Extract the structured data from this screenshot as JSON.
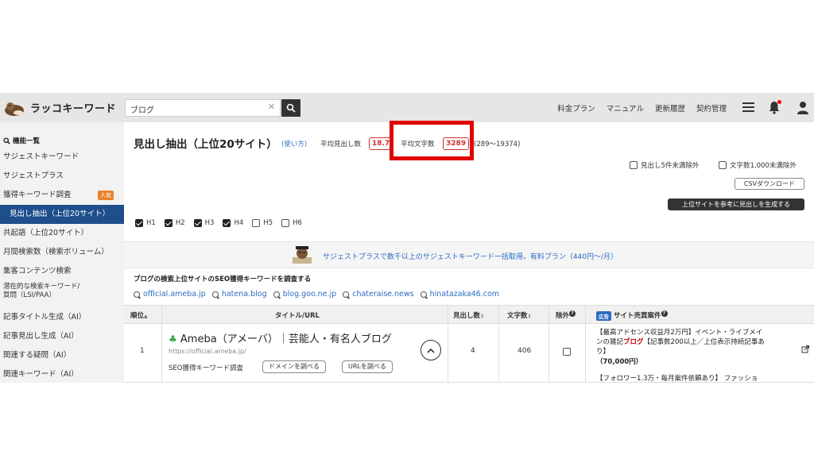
{
  "header": {
    "brand": "ラッコキーワード",
    "search_value": "ブログ",
    "nav": [
      "料金プラン",
      "マニュアル",
      "更新履歴",
      "契約管理"
    ]
  },
  "sidebar": {
    "heading": "機能一覧",
    "items": [
      {
        "label": "サジェストキーワード"
      },
      {
        "label": "サジェストプラス"
      },
      {
        "label": "獲得キーワード調査",
        "badge": "人気"
      },
      {
        "label": "見出し抽出（上位20サイト）",
        "active": true
      },
      {
        "label": "共起語（上位20サイト）"
      },
      {
        "label": "月間検索数（検索ボリューム）"
      },
      {
        "label": "集客コンテンツ検索"
      },
      {
        "label_line1": "潜在的な検索キーワード/",
        "label_line2": "質問（LSI/PAA）"
      },
      {
        "label": "記事タイトル生成（AI）"
      },
      {
        "label": "記事見出し生成（AI）"
      },
      {
        "label": "関連する疑問（AI）"
      },
      {
        "label": "関連キーワード（AI）"
      }
    ]
  },
  "main": {
    "title": "見出し抽出（上位20サイト）",
    "howto": "(使い方)",
    "avg_headings_label": "平均見出し数",
    "avg_headings_value": "18.7",
    "avg_chars_label": "平均文字数",
    "avg_chars_value": "3289",
    "chars_range": "(289～19374)",
    "filter_1": "見出し5件未満除外",
    "filter_2": "文字数1,000未満除外",
    "csv_button": "CSVダウンロード",
    "generate_button": "上位サイトを参考に見出しを生成する",
    "heading_levels": [
      {
        "label": "H1",
        "checked": true
      },
      {
        "label": "H2",
        "checked": true
      },
      {
        "label": "H3",
        "checked": true
      },
      {
        "label": "H4",
        "checked": true
      },
      {
        "label": "H5",
        "checked": false
      },
      {
        "label": "H6",
        "checked": false
      }
    ],
    "promo": "サジェストプラスで数千以上のサジェストキーワード一括取得。有料プラン（440円〜/月）",
    "seo_title": "ブログの検索上位サイトのSEO獲得キーワードを調査する",
    "domains": [
      "official.ameba.jp",
      "hatena.blog",
      "blog.goo.ne.jp",
      "chateraise.news",
      "hinatazaka46.com"
    ]
  },
  "table": {
    "headers": {
      "rank": "順位",
      "title_url": "タイトル/URL",
      "headings": "見出し数",
      "chars": "文字数",
      "exclude": "除外",
      "ad_badge": "広告",
      "deals": "サイト売買案件"
    },
    "rows": [
      {
        "rank": "1",
        "title": "Ameba（アメーバ）｜芸能人・有名人ブログ",
        "url": "https://official.ameba.jp/",
        "seo_label": "SEO獲得キーワード調査",
        "domain_button": "ドメインを調べる",
        "url_button": "URLを調べる",
        "headings": "4",
        "chars": "406"
      }
    ],
    "ad_line1": "【最高アドセンス収益月2万円】イベント・ライブメイ",
    "ad_line2a": "ンの雑記",
    "ad_line2b": "ブログ",
    "ad_line2c": "【記事数200以上／上位表示持続記事あ",
    "ad_line3": "り】",
    "ad_price": "（70,000円）",
    "ad_next": "【フォロワー1.3万・毎月案件依頼あり】 ファッショ"
  }
}
